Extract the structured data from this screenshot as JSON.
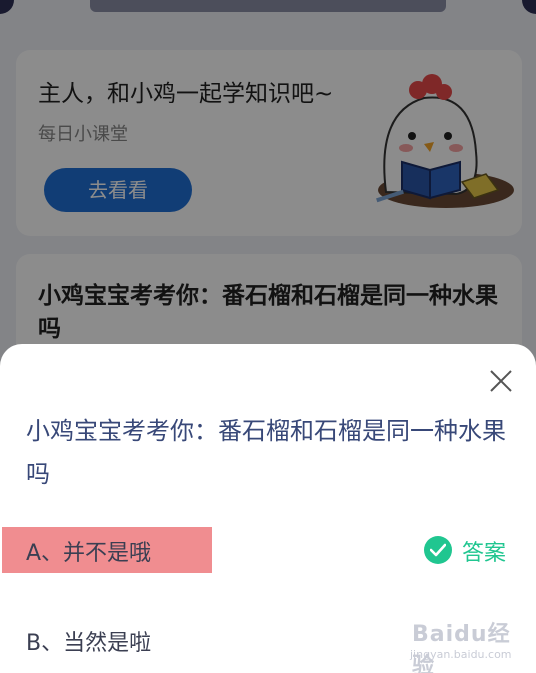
{
  "background": {
    "banner_text": "",
    "card1": {
      "title": "主人，和小鸡一起学知识吧~",
      "subtitle": "每日小课堂",
      "button_label": "去看看"
    },
    "card2": {
      "title": "小鸡宝宝考考你：番石榴和石榴是同一种水果吗"
    }
  },
  "sheet": {
    "question": "小鸡宝宝考考你：番石榴和石榴是同一种水果吗",
    "options": [
      {
        "label": "A、并不是哦",
        "highlighted": true,
        "answer_label": "答案"
      },
      {
        "label": "B、当然是啦",
        "highlighted": false
      }
    ]
  },
  "watermark": {
    "brand": "Baidu经验",
    "url": "jingyan.baidu.com"
  },
  "colors": {
    "accent_blue": "#1f6fd6",
    "question_text": "#384878",
    "highlight": "#f08d90",
    "answer_green": "#20c690"
  },
  "icons": [
    "close-icon",
    "check-circle-icon",
    "chick-illustration"
  ]
}
